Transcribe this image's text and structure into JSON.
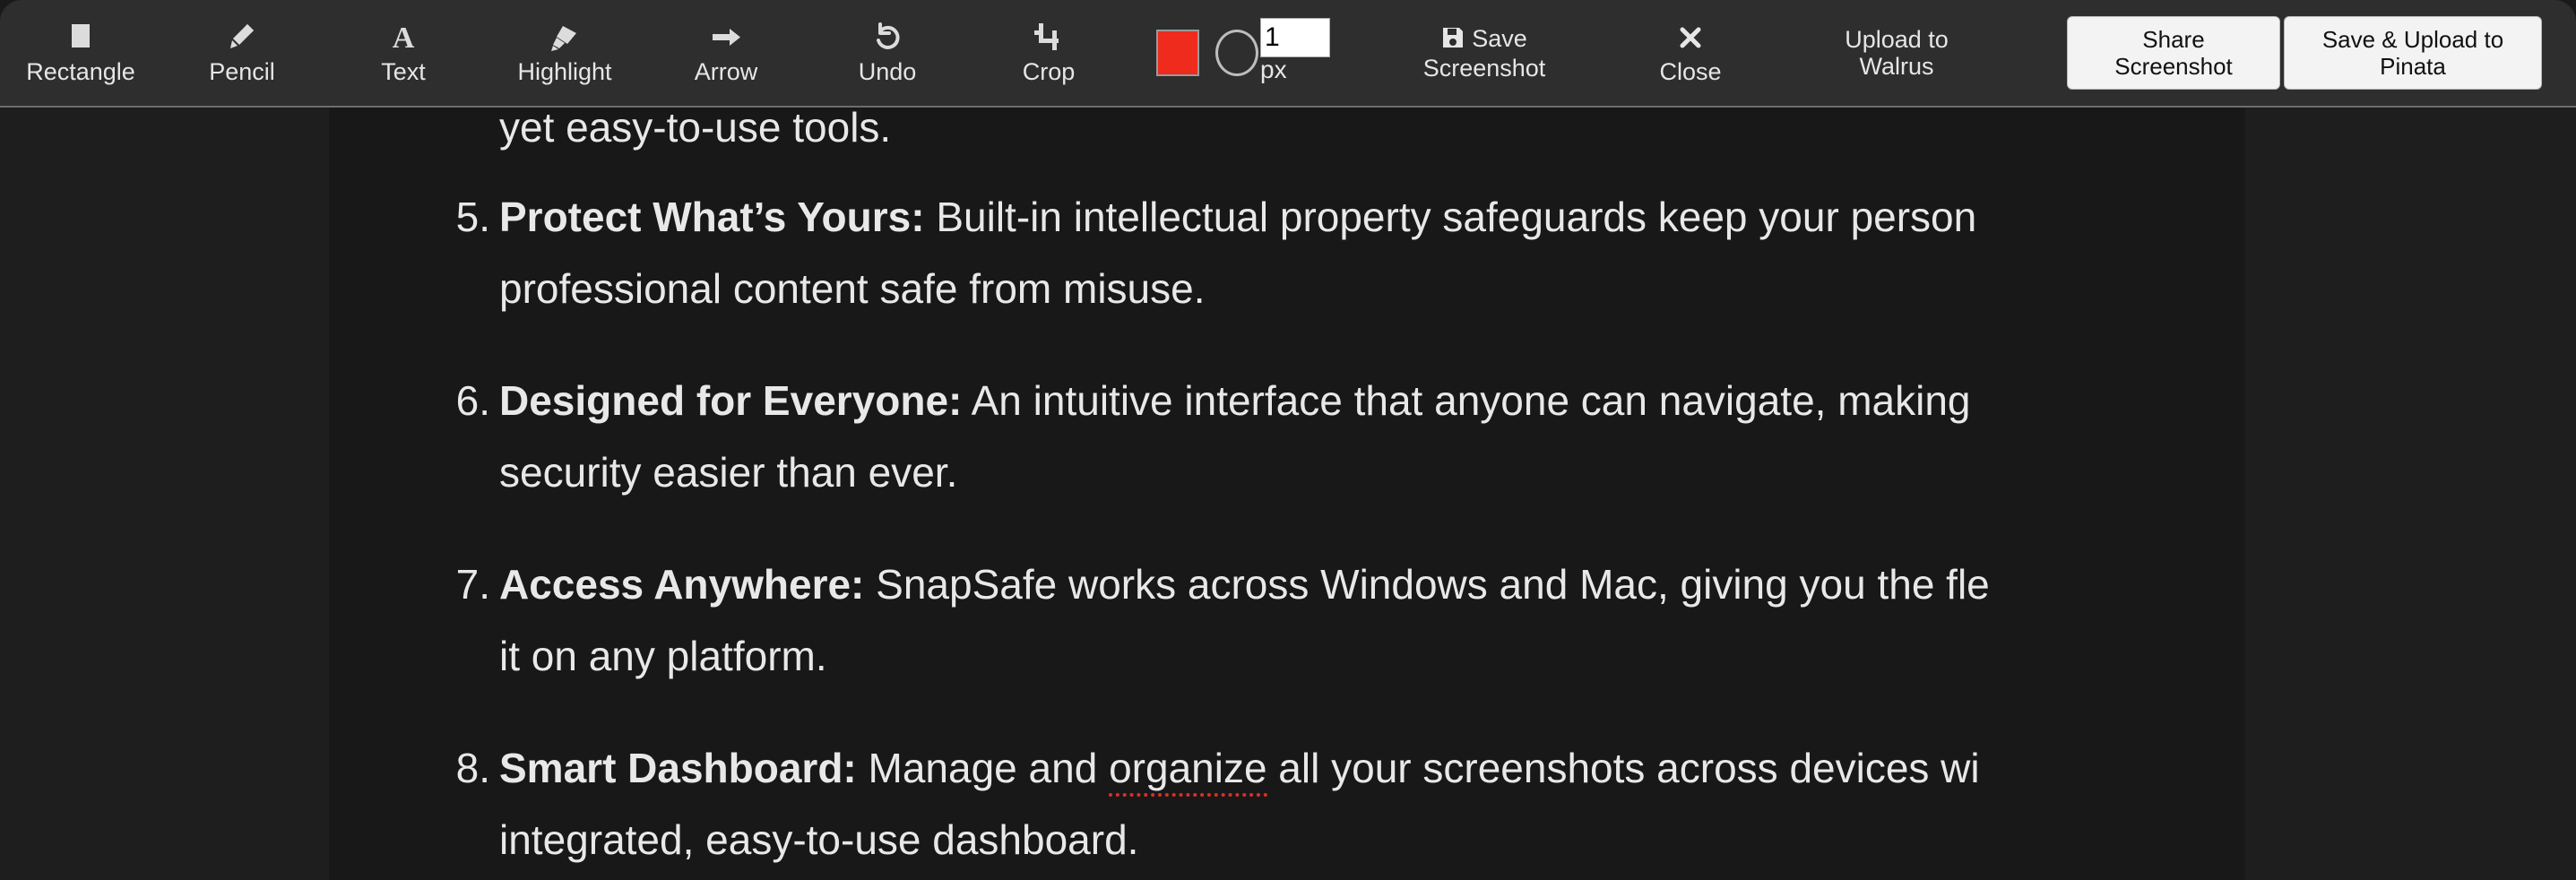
{
  "app": {
    "accent_color": "#ee2b1d",
    "toolbar_bg": "#2e2e2e",
    "canvas_bg": "#181818"
  },
  "toolbar": {
    "tools": [
      {
        "id": "rectangle",
        "label": "Rectangle",
        "icon": "rectangle-icon"
      },
      {
        "id": "pencil",
        "label": "Pencil",
        "icon": "pencil-icon"
      },
      {
        "id": "text",
        "label": "Text",
        "icon": "text-icon"
      },
      {
        "id": "highlight",
        "label": "Highlight",
        "icon": "highlighter-icon"
      },
      {
        "id": "arrow",
        "label": "Arrow",
        "icon": "arrow-right-icon"
      },
      {
        "id": "undo",
        "label": "Undo",
        "icon": "undo-icon"
      },
      {
        "id": "crop",
        "label": "Crop",
        "icon": "crop-icon"
      }
    ],
    "style": {
      "color_value": "#ee2b1d",
      "stroke_size_value": "1",
      "stroke_size_unit": "px"
    },
    "actions": [
      {
        "id": "save-screenshot",
        "label": "Save\nScreenshot",
        "icon": "floppy-save-icon"
      },
      {
        "id": "close",
        "label": "Close",
        "icon": "close-x-icon"
      },
      {
        "id": "upload-walrus",
        "label": "Upload to\nWalrus",
        "icon": "none"
      }
    ],
    "buttons": [
      {
        "id": "share-screenshot",
        "label": "Share\nScreenshot"
      },
      {
        "id": "save-upload-pinata",
        "label": "Save & Upload to\nPinata"
      }
    ]
  },
  "document": {
    "orphan_line": "yet easy-to-use tools.",
    "items": [
      {
        "number": "5.",
        "title": "Protect What’s Yours:",
        "line1_rest": " Built-in intellectual property safeguards keep your person",
        "line2": "professional content safe from misuse."
      },
      {
        "number": "6.",
        "title": "Designed for Everyone:",
        "line1_rest": " An intuitive interface that anyone can navigate, making",
        "line2": "security easier than ever."
      },
      {
        "number": "7.",
        "title": "Access Anywhere:",
        "line1_rest": " SnapSafe works across Windows and Mac, giving you the fle",
        "line2": "it on any platform."
      },
      {
        "number": "8.",
        "title": "Smart Dashboard:",
        "line1_pre": " Manage and ",
        "line1_misspelled": "organize",
        "line1_post": " all your screenshots across devices wi",
        "line2": "integrated, easy-to-use dashboard."
      }
    ]
  }
}
